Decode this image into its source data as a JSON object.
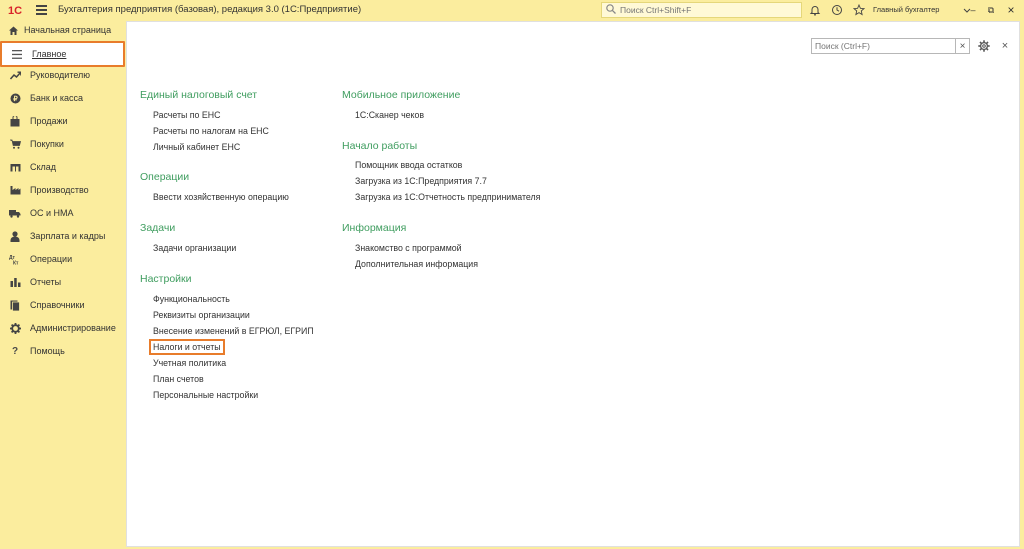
{
  "titlebar": {
    "logo_text": "1С",
    "app_title": "Бухгалтерия предприятия (базовая), редакция 3.0  (1С:Предприятие)",
    "search_placeholder": "Поиск Ctrl+Shift+F",
    "user": "Главный бухгалтер",
    "icons": [
      "menu-icon",
      "bell-icon",
      "history-icon",
      "star-icon"
    ],
    "minimize": "–",
    "restore": "⧉",
    "close": "×"
  },
  "sidebar": {
    "home_label": "Начальная страница",
    "items": [
      {
        "label": "Главное",
        "icon": "list-icon",
        "active": true
      },
      {
        "label": "Руководителю",
        "icon": "trend-icon"
      },
      {
        "label": "Банк и касса",
        "icon": "coin-icon"
      },
      {
        "label": "Продажи",
        "icon": "bag-icon"
      },
      {
        "label": "Покупки",
        "icon": "cart-icon"
      },
      {
        "label": "Склад",
        "icon": "warehouse-icon"
      },
      {
        "label": "Производство",
        "icon": "factory-icon"
      },
      {
        "label": "ОС и НМА",
        "icon": "truck-icon"
      },
      {
        "label": "Зарплата и кадры",
        "icon": "person-icon"
      },
      {
        "label": "Операции",
        "icon": "dt-kt-icon"
      },
      {
        "label": "Отчеты",
        "icon": "bar-chart-icon"
      },
      {
        "label": "Справочники",
        "icon": "books-icon"
      },
      {
        "label": "Администрирование",
        "icon": "gear-icon"
      },
      {
        "label": "Помощь",
        "icon": "question-icon"
      }
    ]
  },
  "main": {
    "search_placeholder": "Поиск (Ctrl+F)",
    "search_clear": "×",
    "close": "×",
    "left_column": [
      {
        "title": "Единый налоговый счет",
        "links": [
          "Расчеты по ЕНС",
          "Расчеты по налогам на ЕНС",
          "Личный кабинет ЕНС"
        ]
      },
      {
        "title": "Операции",
        "links": [
          "Ввести хозяйственную операцию"
        ]
      },
      {
        "title": "Задачи",
        "links": [
          "Задачи организации"
        ]
      },
      {
        "title": "Настройки",
        "links": [
          "Функциональность",
          "Реквизиты организации",
          "Внесение изменений в ЕГРЮЛ, ЕГРИП",
          "Налоги и отчеты",
          "Учетная политика",
          "План счетов",
          "Персональные настройки"
        ]
      }
    ],
    "right_column": [
      {
        "title": "Мобильное приложение",
        "links": [
          "1С:Сканер чеков"
        ]
      },
      {
        "title": "Начало работы",
        "links": [
          "Помощник ввода остатков",
          "Загрузка из 1С:Предприятия 7.7",
          "Загрузка из 1С:Отчетность предпринимателя"
        ]
      },
      {
        "title": "Информация",
        "links": [
          "Знакомство с программой",
          "Дополнительная информация"
        ]
      }
    ]
  },
  "colors": {
    "accent_yellow": "#fbed9e",
    "section_green": "#3f9d5f",
    "highlight_orange": "#e87c2b",
    "logo_red": "#d8232a"
  }
}
